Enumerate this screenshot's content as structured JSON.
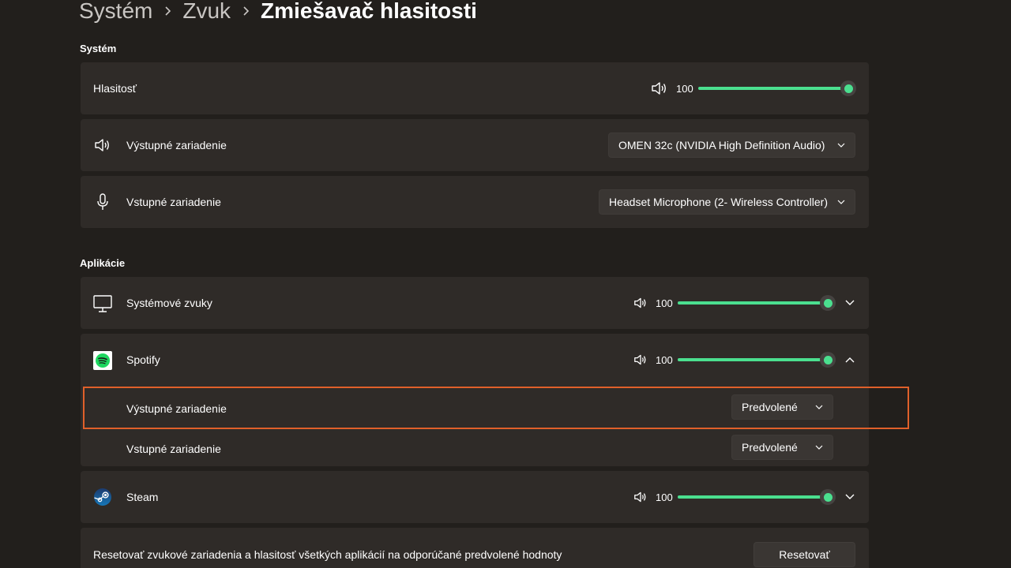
{
  "breadcrumb": {
    "items": [
      "Systém",
      "Zvuk"
    ],
    "current": "Zmiešavač hlasitosti"
  },
  "system": {
    "section_title": "Systém",
    "volume": {
      "label": "Hlasitosť",
      "value": "100",
      "level_percent": 100,
      "icon": "speaker-icon"
    },
    "output": {
      "label": "Výstupné zariadenie",
      "selected": "OMEN 32c (NVIDIA High Definition Audio)",
      "icon": "speaker-icon"
    },
    "input": {
      "label": "Vstupné zariadenie",
      "selected": "Headset Microphone (2- Wireless Controller)",
      "icon": "microphone-icon"
    }
  },
  "apps": {
    "section_title": "Aplikácie",
    "items": [
      {
        "name": "Systémové zvuky",
        "volume": "100",
        "level_percent": 100,
        "icon": "monitor-icon",
        "expanded": false
      },
      {
        "name": "Spotify",
        "volume": "100",
        "level_percent": 100,
        "icon": "spotify-icon",
        "expanded": true,
        "output_label": "Výstupné zariadenie",
        "output_selected": "Predvolené",
        "input_label": "Vstupné zariadenie",
        "input_selected": "Predvolené"
      },
      {
        "name": "Steam",
        "volume": "100",
        "level_percent": 100,
        "icon": "steam-icon",
        "expanded": false
      }
    ]
  },
  "reset": {
    "label": "Resetovať zvukové zariadenia a hlasitosť všetkých aplikácií na odporúčané predvolené hodnoty",
    "button": "Resetovať"
  },
  "colors": {
    "background": "#221f1c",
    "card": "#2f2b28",
    "accent": "#4bdf8f",
    "highlight": "#e0602a"
  }
}
